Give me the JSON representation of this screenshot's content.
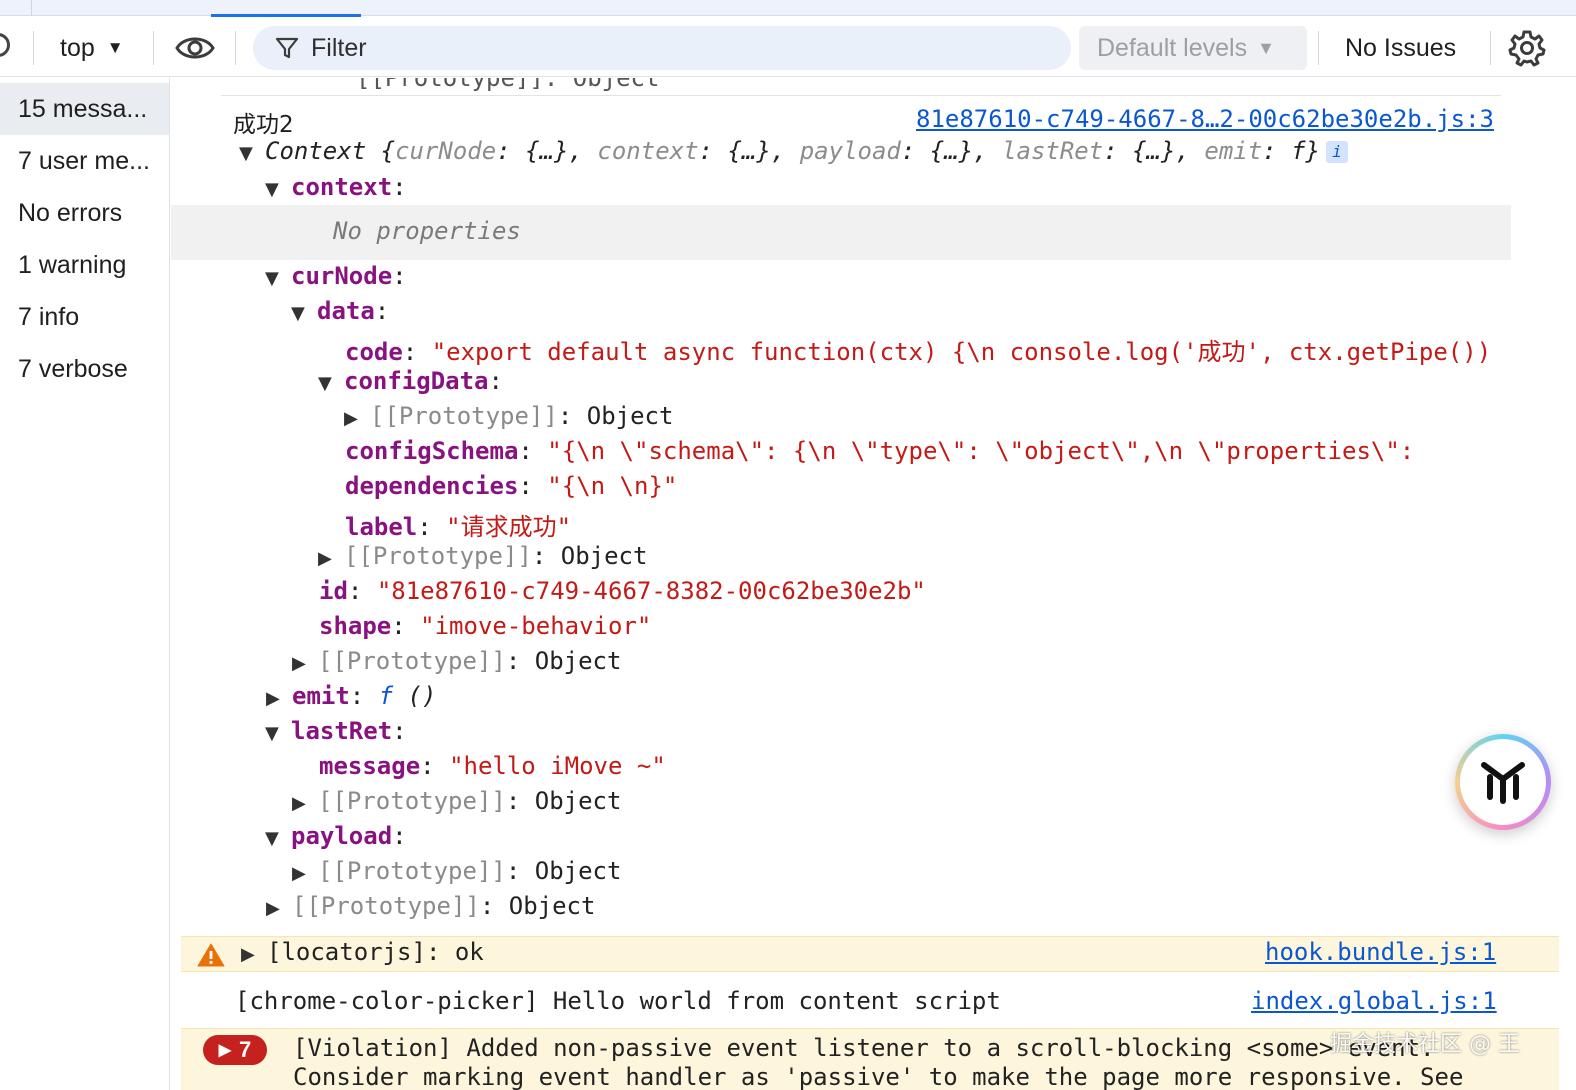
{
  "toolbar": {
    "context": "top",
    "filter_placeholder": "Filter",
    "levels": "Default levels",
    "issues": "No Issues"
  },
  "sidebar": {
    "items": [
      {
        "label": "15 messa..."
      },
      {
        "label": "7 user me..."
      },
      {
        "label": "No errors"
      },
      {
        "label": "1 warning"
      },
      {
        "label": "7 info"
      },
      {
        "label": "7 verbose"
      }
    ]
  },
  "console": {
    "prev_line": "[[Prototype]]: Object",
    "log_text": "成功2",
    "log_source": "81e87610-c749-4667-8…2-00c62be30e2b.js:3",
    "context_label": "Context",
    "preview": {
      "open": "{",
      "k1": "curNode",
      "v1": "{…}",
      "k2": "context",
      "v2": "{…}",
      "k3": "payload",
      "v3": "{…}",
      "k4": "lastRet",
      "v4": "{…}",
      "k5": "emit",
      "v5": "f",
      "close": "}"
    },
    "info_badge": "i",
    "no_properties": "No properties",
    "keys": {
      "context": "context",
      "curNode": "curNode",
      "data": "data",
      "code": "code",
      "configData": "configData",
      "configSchema": "configSchema",
      "dependencies": "dependencies",
      "label": "label",
      "id": "id",
      "shape": "shape",
      "emit": "emit",
      "lastRet": "lastRet",
      "message": "message",
      "payload": "payload"
    },
    "values": {
      "code": "\"export default async function(ctx) {\\n  console.log('成功', ctx.getPipe())",
      "configSchema": "\"{\\n  \\\"schema\\\": {\\n    \\\"type\\\": \\\"object\\\",\\n    \\\"properties\\\":",
      "dependencies": "\"{\\n  \\n}\"",
      "label": "\"请求成功\"",
      "id": "\"81e87610-c749-4667-8382-00c62be30e2b\"",
      "shape": "\"imove-behavior\"",
      "emit_f": "f",
      "emit_args": "()",
      "message": "\"hello iMove ~\""
    },
    "proto_key": "[[Prototype]]",
    "proto_value": "Object",
    "warning_text": "[locatorjs]: ok",
    "warning_source": "hook.bundle.js:1",
    "info_text": "[chrome-color-picker] Hello world from content script",
    "info_source": "index.global.js:1",
    "violation_count": "7",
    "violation_line1": "[Violation] Added non-passive event listener to a scroll-blocking <some> event.",
    "violation_line2": "Consider marking event handler as 'passive' to make the page more responsive. See"
  },
  "watermark": "掘金技术社区 @ 王",
  "icons": {
    "eye": "eye-icon",
    "filter": "filter-icon",
    "gear": "gear-icon",
    "warning": "warning-triangle-icon",
    "fab": "assistant-logo-icon"
  },
  "colors": {
    "accent": "#1a73e8",
    "key": "#881280",
    "string": "#c41a16",
    "link": "#0b57d0",
    "warning_bg": "#fdf6dd",
    "badge_red": "#c5221f"
  }
}
